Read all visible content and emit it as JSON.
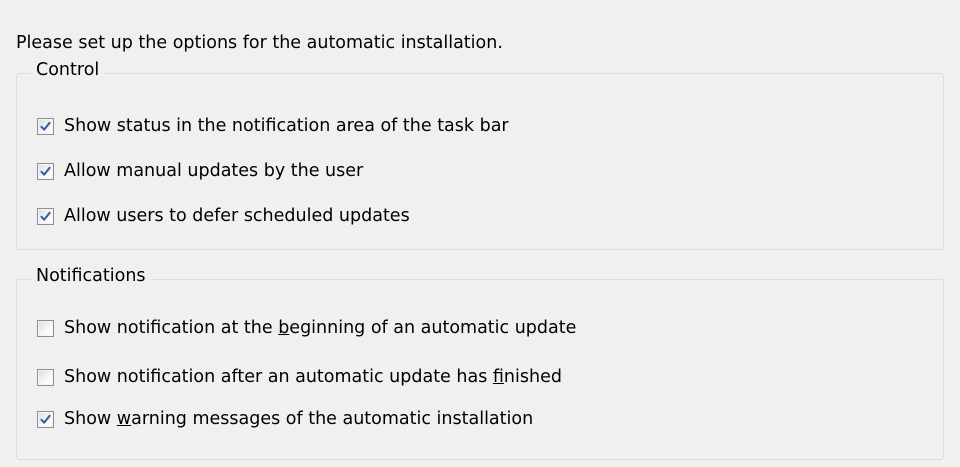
{
  "intro": "Please set up the options for the automatic installation.",
  "colors": {
    "background": "#f0f0f0",
    "group_border": "#d5dfe5",
    "check_mark": "#3b5fa6"
  },
  "control": {
    "title": "Control",
    "options": [
      {
        "label": "Show status in the notification area of the task bar",
        "checked": true
      },
      {
        "label": "Allow manual updates by the user",
        "checked": true
      },
      {
        "label": "Allow users to defer scheduled updates",
        "checked": true
      }
    ]
  },
  "notifications": {
    "title": "Notifications",
    "options": [
      {
        "label": "Show notification at the beginning of an automatic update",
        "checked": false,
        "mnemonic": "b"
      },
      {
        "label": "Show notification after an automatic update has finished",
        "checked": false,
        "mnemonic": "f"
      },
      {
        "label": "Show warning messages of the automatic installation",
        "checked": true,
        "mnemonic": "w"
      }
    ]
  }
}
